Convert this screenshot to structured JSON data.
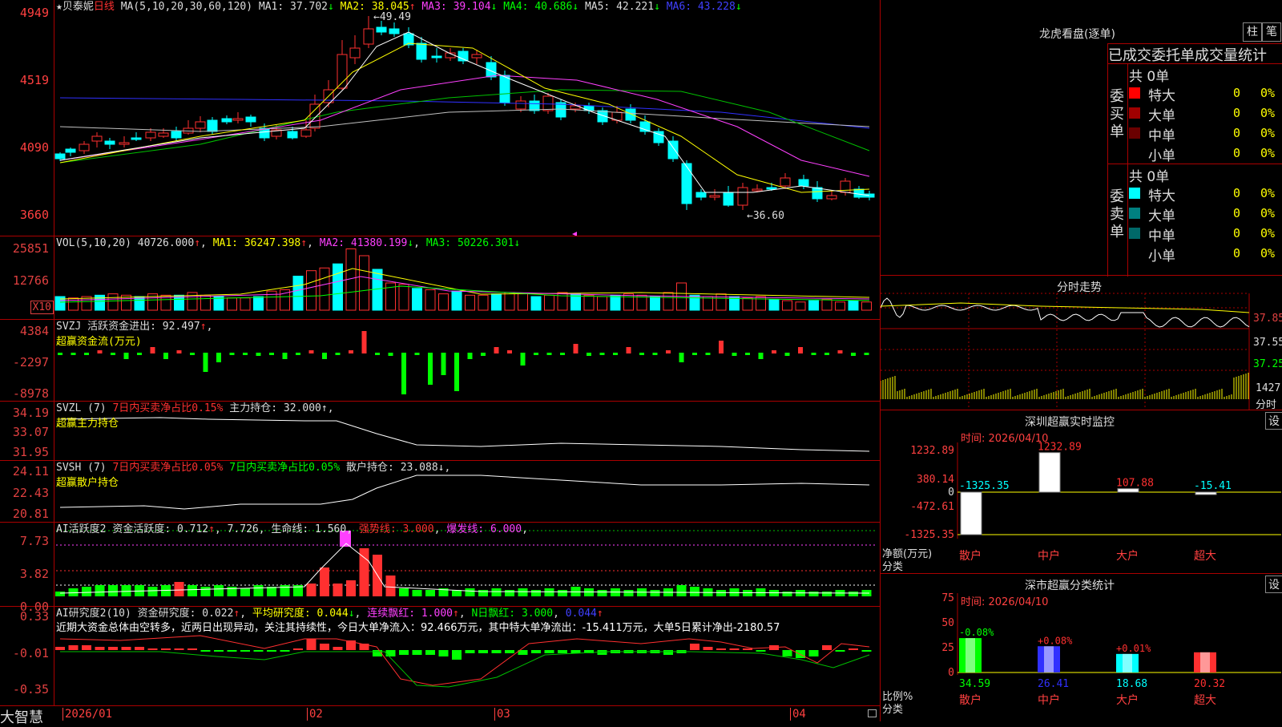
{
  "stock": {
    "name": "贝泰妮",
    "period": "日线",
    "ma_params": "MA(5,10,20,30,60,120)",
    "ma": [
      {
        "k": "MA1",
        "v": "37.702",
        "arrow": "↓"
      },
      {
        "k": "MA2",
        "v": "38.045",
        "arrow": "↑"
      },
      {
        "k": "MA3",
        "v": "39.104",
        "arrow": "↓"
      },
      {
        "k": "MA4",
        "v": "40.686",
        "arrow": "↓"
      },
      {
        "k": "MA5",
        "v": "42.221",
        "arrow": "↓"
      },
      {
        "k": "MA6",
        "v": "43.228",
        "arrow": "↓"
      }
    ],
    "high_label": "49.49",
    "low_label": "←36.60",
    "price_axis": [
      "4949",
      "4519",
      "4090",
      "3660"
    ]
  },
  "volume": {
    "label": "VOL(5,10,20)",
    "value": "40726.000",
    "arrow": "↑",
    "ma1": "MA1: 36247.398",
    "ma1_arrow": "↑",
    "ma2": "MA2: 41380.199",
    "ma2_arrow": "↓",
    "ma3": "MA3: 50226.301",
    "ma3_arrow": "↓",
    "axis": [
      "25851",
      "12766"
    ],
    "unit": "X10"
  },
  "svzj": {
    "label": "SVZJ",
    "desc": "活跃资金进出:",
    "value": "92.497",
    "arrow": "↑",
    "subtitle": "超赢资金流(万元)",
    "axis": [
      "4384",
      "-2297",
      "-8978"
    ]
  },
  "svzl": {
    "label": "SVZL (7)",
    "t1": "7日内买卖净占比0.15%",
    "t2": "主力持仓: 32.000",
    "t2_suffix": "↑,",
    "subtitle": "超赢主力持仓",
    "axis": [
      "34.19",
      "33.07",
      "31.95"
    ]
  },
  "svsh": {
    "label": "SVSH (7)",
    "t1": "7日内买卖净占比0.05%",
    "t2": "7日内买卖净占比0.05%",
    "t3": "散户持仓: 23.088",
    "t3_suffix": "↓,",
    "subtitle": "超赢散户持仓",
    "axis": [
      "24.11",
      "22.43",
      "20.81"
    ]
  },
  "ai1": {
    "label": "AI活跃度2",
    "t1": "资金活跃度: 0.712",
    "t1_arrow": "↑",
    "t2": "7.726",
    "t3": "生命线: 1.560",
    "t4": "强势线: 3.000",
    "t5": "爆发线: 6.000",
    "axis": [
      "7.73",
      "3.82",
      "0.00"
    ]
  },
  "ai2": {
    "label": "AI研究度2(10)",
    "t1": "资金研究度: 0.022",
    "t1_arrow": "↑",
    "t2": "平均研究度: 0.044",
    "t2_arrow": "↓",
    "t3": "连续飘红: 1.000",
    "t3_arrow": "↑",
    "t4": "N日飘红: 3.000",
    "t5": "0.044",
    "t5_arrow": "↑",
    "comment": "近期大资金总体由空转多，近两日出现异动，关注其持续性，今日大单净流入：92.466万元，其中特大单净流出：-15.411万元，大单5日累计净出-2180.57",
    "axis": [
      "0.33",
      "-0.01",
      "-0.35"
    ]
  },
  "dates": [
    "2026/01",
    "02",
    "03",
    "04"
  ],
  "brand": "大智慧",
  "right": {
    "title": "龙虎看盘(逐单)",
    "tab1": "柱",
    "tab2": "笔",
    "table_title": "已成交委托单成交量统计",
    "buy": {
      "side": "委买单",
      "total": "共 0单",
      "rows": [
        {
          "name": "特大",
          "val": "0",
          "pct": "0%",
          "color": "#ff0000"
        },
        {
          "name": "大单",
          "val": "0",
          "pct": "0%",
          "color": "#a00000"
        },
        {
          "name": "中单",
          "val": "0",
          "pct": "0%",
          "color": "#6a0000"
        },
        {
          "name": "小单",
          "val": "0",
          "pct": "0%",
          "color": "#000"
        }
      ]
    },
    "sell": {
      "side": "委卖单",
      "total": "共 0单",
      "rows": [
        {
          "name": "特大",
          "val": "0",
          "pct": "0%",
          "color": "#00ffff"
        },
        {
          "name": "大单",
          "val": "0",
          "pct": "0%",
          "color": "#008080"
        },
        {
          "name": "中单",
          "val": "0",
          "pct": "0%",
          "color": "#006868"
        },
        {
          "name": "小单",
          "val": "0",
          "pct": "0%",
          "color": "#000"
        }
      ]
    },
    "intraday": {
      "title": "分时走势",
      "y": [
        "37.85",
        "37.55",
        "37.25"
      ],
      "vol": "1427",
      "vol_unit": "分时"
    },
    "monitor": {
      "title": "深圳超赢实时监控",
      "btn": "设",
      "time": "时间: 2026/04/10",
      "axis": [
        "1232.89",
        "380.14",
        "0",
        "-472.61",
        "-1325.35"
      ],
      "ylabel": "净额(万元)",
      "xlabel": "分类",
      "cats": [
        "散户",
        "中户",
        "大户",
        "超大"
      ],
      "values": [
        -1325.35,
        1232.89,
        107.88,
        -15.41
      ],
      "labels": [
        "-1325.35",
        "1232.89",
        "107.88",
        "-15.41"
      ]
    },
    "classify": {
      "title": "深市超赢分类统计",
      "btn": "设",
      "time": "时间: 2026/04/10",
      "axis": [
        "75",
        "50",
        "25",
        "0"
      ],
      "ylabel": "比例%",
      "xlabel": "分类",
      "cats": [
        "散户",
        "中户",
        "大户",
        "超大"
      ],
      "values": [
        34.59,
        26.41,
        18.68,
        20.32
      ],
      "labels": [
        "34.59",
        "26.41",
        "18.68",
        "20.32"
      ],
      "changes": [
        "-0.08%",
        "+0.08%",
        "+0.01%",
        ""
      ]
    }
  }
}
